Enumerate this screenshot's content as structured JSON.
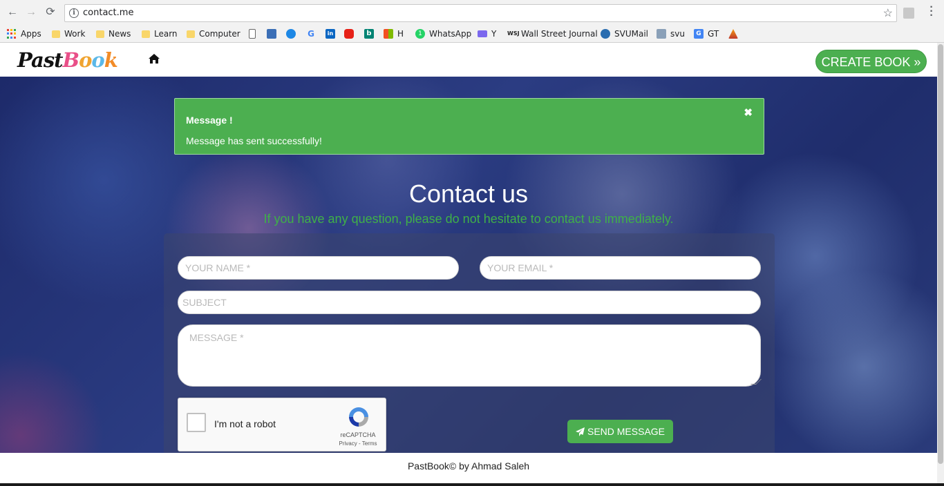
{
  "browser": {
    "url": "contact.me",
    "bookmarks": [
      {
        "label": "Apps",
        "icon": "apps-icon"
      },
      {
        "label": "Work",
        "icon": "folder-icon"
      },
      {
        "label": "News",
        "icon": "folder-icon"
      },
      {
        "label": "Learn",
        "icon": "folder-icon"
      },
      {
        "label": "Computer",
        "icon": "folder-icon"
      },
      {
        "label": "",
        "icon": "page-icon"
      },
      {
        "label": "",
        "icon": "bookmark-icon"
      },
      {
        "label": "",
        "icon": "play-icon"
      },
      {
        "label": "",
        "icon": "google-icon"
      },
      {
        "label": "",
        "icon": "linkedin-icon"
      },
      {
        "label": "",
        "icon": "youtube-icon"
      },
      {
        "label": "",
        "icon": "bing-icon"
      },
      {
        "label": "H",
        "icon": "windows-icon"
      },
      {
        "label": "WhatsApp",
        "icon": "whatsapp-icon"
      },
      {
        "label": "Y",
        "icon": "mail-icon"
      },
      {
        "label": "Wall Street Journal",
        "icon": "wsj-icon"
      },
      {
        "label": "SVUMail",
        "icon": "svumail-icon"
      },
      {
        "label": "svu",
        "icon": "svu-icon"
      },
      {
        "label": "GT",
        "icon": "translate-icon"
      },
      {
        "label": "",
        "icon": "pma-icon"
      }
    ]
  },
  "header": {
    "logo_part1": "Past",
    "logo_part2": [
      "B",
      "o",
      "o",
      "k"
    ],
    "create_button": "CREATE BOOK »"
  },
  "alert": {
    "title": "Message !",
    "text": "Message has sent successfully!",
    "close": "✖"
  },
  "contact": {
    "title": "Contact us",
    "subtitle": "If you have any question, please do not hesitate to contact us immediately."
  },
  "form": {
    "name_placeholder": "YOUR NAME *",
    "email_placeholder": "YOUR EMAIL *",
    "subject_placeholder": "SUBJECT",
    "message_placeholder": "MESSAGE *",
    "captcha_label": "I'm not a robot",
    "captcha_brand": "reCAPTCHA",
    "captcha_links": "Privacy - Terms",
    "send_button": "SEND MESSAGE"
  },
  "footer": {
    "text": "PastBook© by Ahmad Saleh"
  },
  "colors": {
    "accent_green": "#4caf50",
    "subtitle_green": "#3fb048",
    "hero_blue": "#2b3c82"
  }
}
